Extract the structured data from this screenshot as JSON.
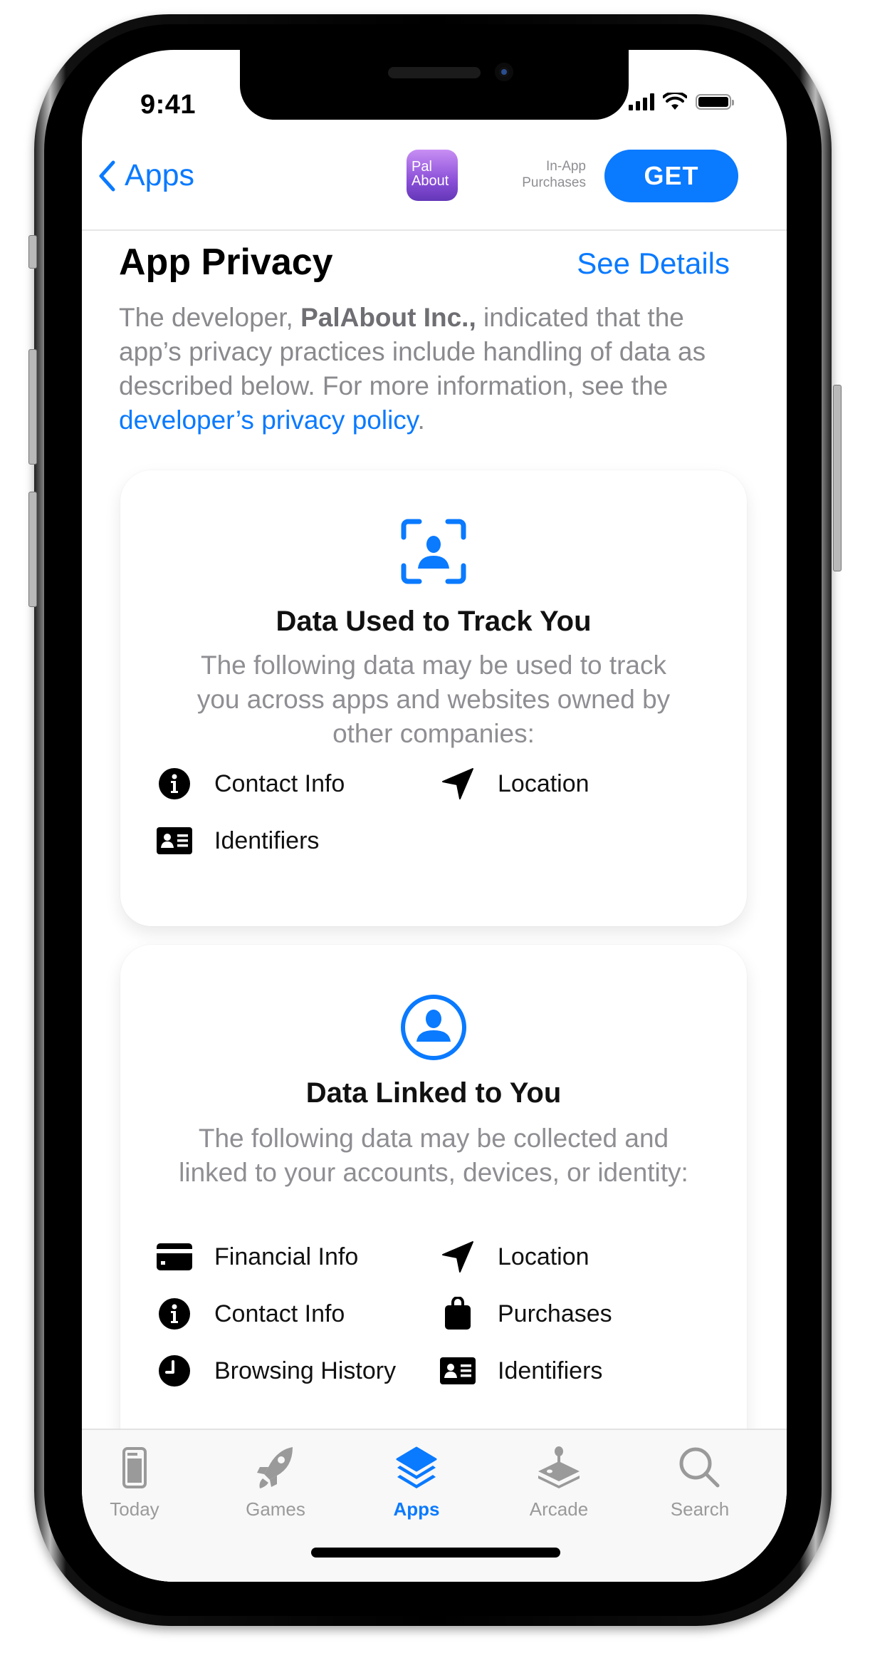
{
  "status_bar": {
    "time": "9:41"
  },
  "nav": {
    "back_label": "Apps",
    "app_icon_text_line1": "Pal",
    "app_icon_text_line2": "About",
    "iap_line1": "In-App",
    "iap_line2": "Purchases",
    "get_label": "GET"
  },
  "privacy": {
    "title": "App Privacy",
    "see_details": "See Details",
    "desc_prefix": "The developer, ",
    "developer": "PalAbout Inc.,",
    "desc_middle": " indicated that the app’s privacy practices include handling of data as described below. For more information, see the ",
    "policy_link": "developer’s privacy policy",
    "desc_suffix": "."
  },
  "cards": [
    {
      "icon": "tracking-person-icon",
      "title": "Data Used to Track You",
      "description": "The following data may be used to track you across apps and websites owned by other companies:",
      "items": [
        {
          "icon": "info-circle-icon",
          "label": "Contact Info"
        },
        {
          "icon": "location-arrow-icon",
          "label": "Location"
        },
        {
          "icon": "id-card-icon",
          "label": "Identifiers"
        }
      ]
    },
    {
      "icon": "person-circle-icon",
      "title": "Data Linked to You",
      "description": "The following data may be collected and linked to your accounts, devices, or identity:",
      "items": [
        {
          "icon": "credit-card-icon",
          "label": "Financial Info"
        },
        {
          "icon": "location-arrow-icon",
          "label": "Location"
        },
        {
          "icon": "info-circle-icon",
          "label": "Contact Info"
        },
        {
          "icon": "shopping-bag-icon",
          "label": "Purchases"
        },
        {
          "icon": "clock-icon",
          "label": "Browsing History"
        },
        {
          "icon": "id-card-icon",
          "label": "Identifiers"
        }
      ]
    }
  ],
  "tabbar": {
    "tabs": [
      {
        "label": "Today",
        "icon": "today-icon",
        "active": false
      },
      {
        "label": "Games",
        "icon": "rocket-icon",
        "active": false
      },
      {
        "label": "Apps",
        "icon": "layers-icon",
        "active": true
      },
      {
        "label": "Arcade",
        "icon": "joystick-icon",
        "active": false
      },
      {
        "label": "Search",
        "icon": "search-icon",
        "active": false
      }
    ]
  },
  "colors": {
    "accent": "#0a7aff",
    "secondary_text": "#8e8e93",
    "tab_inactive": "#9a9a9a"
  }
}
